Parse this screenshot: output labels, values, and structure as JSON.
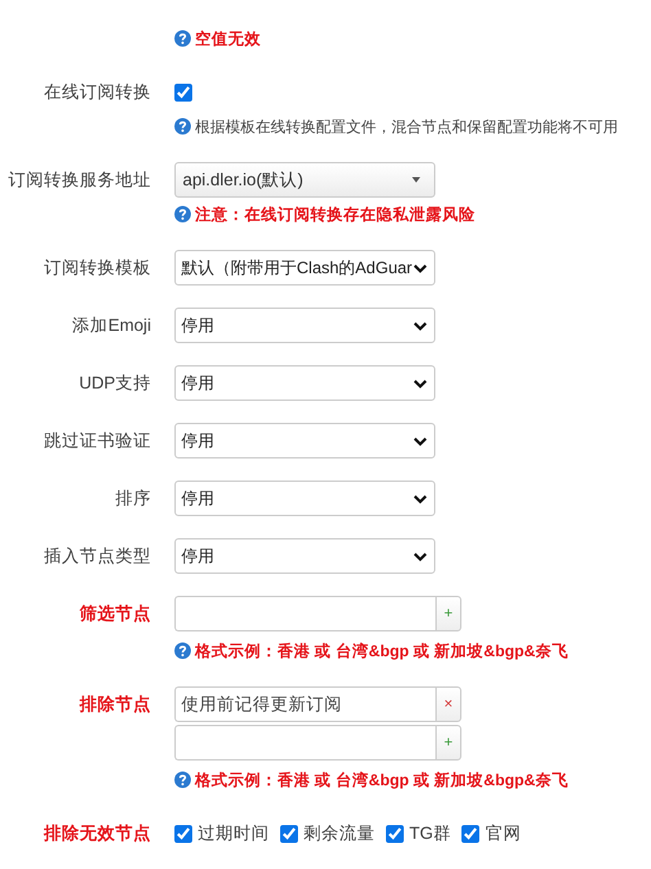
{
  "rows": [
    {
      "kind": "hint",
      "hints": [
        {
          "text": "空值无效",
          "alert": true
        }
      ]
    },
    {
      "kind": "checkbox",
      "label": "在线订阅转换",
      "label_alert": false,
      "checked": true,
      "hints": [
        {
          "text": "根据模板在线转换配置文件，混合节点和保留配置功能将不可用",
          "alert": false
        }
      ]
    },
    {
      "kind": "combo",
      "label": "订阅转换服务地址",
      "label_alert": false,
      "value": "api.dler.io(默认)",
      "hints": [
        {
          "text": "注意：在线订阅转换存在隐私泄露风险",
          "alert": true
        }
      ]
    },
    {
      "kind": "select",
      "label": "订阅转换模板",
      "label_alert": false,
      "value": "默认（附带用于Clash的AdGuar"
    },
    {
      "kind": "select",
      "label": "添加Emoji",
      "label_alert": false,
      "value": "停用"
    },
    {
      "kind": "select",
      "label": "UDP支持",
      "label_alert": false,
      "value": "停用"
    },
    {
      "kind": "select",
      "label": "跳过证书验证",
      "label_alert": false,
      "value": "停用"
    },
    {
      "kind": "select",
      "label": "排序",
      "label_alert": false,
      "value": "停用"
    },
    {
      "kind": "select",
      "label": "插入节点类型",
      "label_alert": false,
      "value": "停用"
    },
    {
      "kind": "dynlist",
      "label": "筛选节点",
      "label_alert": true,
      "items": [
        {
          "value": "",
          "kind": "add",
          "button": "+"
        }
      ],
      "hints": [
        {
          "text": "格式示例：香港 或 台湾&bgp 或 新加坡&bgp&奈飞",
          "alert": true
        }
      ]
    },
    {
      "kind": "dynlist",
      "label": "排除节点",
      "label_alert": true,
      "items": [
        {
          "value": "使用前记得更新订阅",
          "kind": "remove",
          "button": "×"
        },
        {
          "value": "",
          "kind": "add",
          "button": "+"
        }
      ],
      "hints": [
        {
          "text": "格式示例：香港 或 台湾&bgp 或 新加坡&bgp&奈飞",
          "alert": true
        }
      ]
    },
    {
      "kind": "checkgroup",
      "label": "排除无效节点",
      "label_alert": true,
      "options": [
        {
          "label": "过期时间",
          "checked": true
        },
        {
          "label": "剩余流量",
          "checked": true
        },
        {
          "label": "TG群",
          "checked": true
        },
        {
          "label": "官网",
          "checked": true
        }
      ]
    }
  ]
}
